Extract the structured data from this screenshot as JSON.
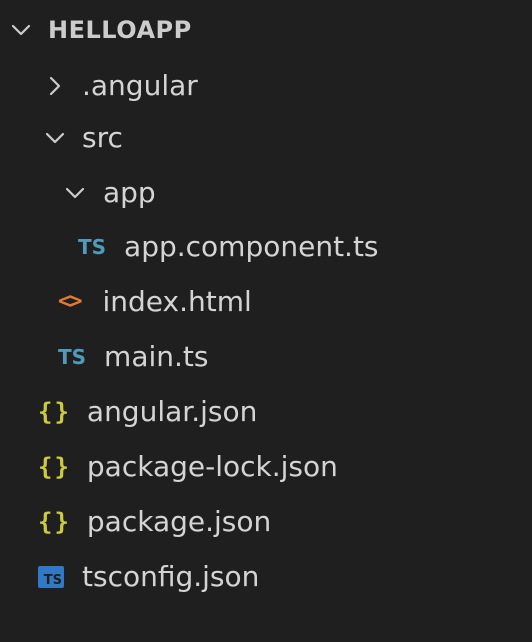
{
  "explorer": {
    "root": {
      "label": "HELLOAPP",
      "icon": "chevron-down-icon"
    },
    "items": [
      {
        "label": ".angular",
        "kind": "folder",
        "expanded": false,
        "icon": "chevron-right-icon"
      },
      {
        "label": "src",
        "kind": "folder",
        "expanded": true,
        "icon": "chevron-down-icon"
      },
      {
        "label": "app",
        "kind": "folder",
        "expanded": true,
        "icon": "chevron-down-icon"
      },
      {
        "label": "app.component.ts",
        "kind": "file",
        "icon": "typescript-file-icon",
        "icon_text": "TS"
      },
      {
        "label": "index.html",
        "kind": "file",
        "icon": "html-file-icon",
        "icon_text": "<>"
      },
      {
        "label": "main.ts",
        "kind": "file",
        "icon": "typescript-file-icon",
        "icon_text": "TS"
      },
      {
        "label": "angular.json",
        "kind": "file",
        "icon": "json-file-icon",
        "icon_text": "{}"
      },
      {
        "label": "package-lock.json",
        "kind": "file",
        "icon": "json-file-icon",
        "icon_text": "{}"
      },
      {
        "label": "package.json",
        "kind": "file",
        "icon": "json-file-icon",
        "icon_text": "{}"
      },
      {
        "label": "tsconfig.json",
        "kind": "file",
        "icon": "tsconfig-file-icon",
        "icon_text": "TS"
      }
    ]
  },
  "colors": {
    "background": "#1f1f1f",
    "text": "#d4d4d4",
    "ts_blue": "#519aba",
    "json_yellow": "#cbcb41",
    "html_orange": "#e37933",
    "tsconfig_blue": "#3178c6"
  }
}
